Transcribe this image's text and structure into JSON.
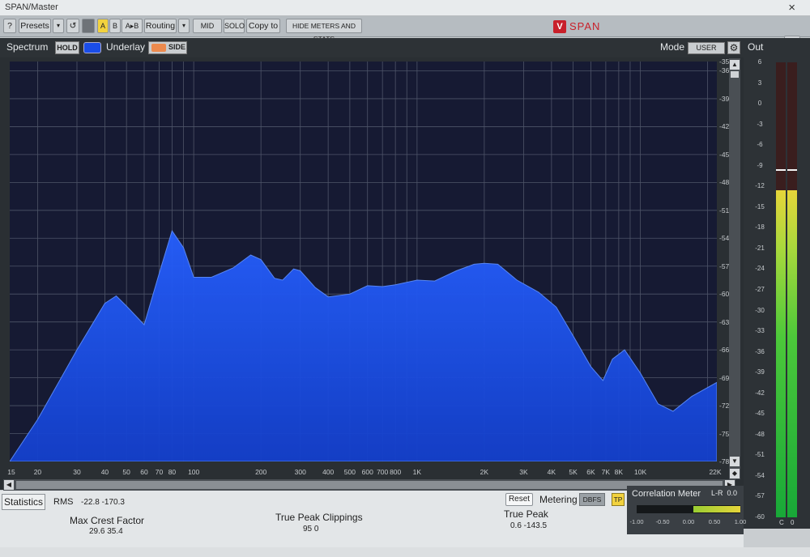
{
  "window": {
    "title": "SPAN/Master",
    "close": "×"
  },
  "toolbar": {
    "help": "?",
    "presets": "Presets",
    "dropdown": "▾",
    "undo": "↺",
    "a": "A",
    "b": "B",
    "ab": "A▸B",
    "routing": "Routing",
    "mid": "MID",
    "solo": "SOLO",
    "copy_to": "Copy to",
    "hide_meters": "HIDE METERS AND STATS",
    "brand": "SPAN",
    "logo": "V"
  },
  "spectrum": {
    "label": "Spectrum",
    "hold": "HOLD",
    "underlay": "Underlay",
    "side": "SIDE",
    "mode_label": "Mode",
    "mode_value": "USER",
    "gear": "⚙",
    "db_ticks": [
      "-35",
      "-36",
      "-39",
      "-42",
      "-45",
      "-48",
      "-51",
      "-54",
      "-57",
      "-60",
      "-63",
      "-66",
      "-69",
      "-72",
      "-75",
      "-78"
    ],
    "freq_ticks": [
      "15",
      "20",
      "30",
      "40",
      "50",
      "60",
      "70",
      "80",
      "100",
      "200",
      "300",
      "400",
      "500",
      "600",
      "700",
      "800",
      "1K",
      "2K",
      "3K",
      "4K",
      "5K",
      "6K",
      "7K",
      "8K",
      "10K",
      "22K"
    ],
    "colors": {
      "fill": "#1a4de8",
      "background": "#161a33",
      "grid": "#5a5f70"
    }
  },
  "output": {
    "label": "Out",
    "db_ticks": [
      "6",
      "3",
      "0",
      "-3",
      "-6",
      "-9",
      "-12",
      "-15",
      "-18",
      "-21",
      "-24",
      "-27",
      "-30",
      "-33",
      "-36",
      "-39",
      "-42",
      "-45",
      "-48",
      "-51",
      "-54",
      "-57",
      "-60"
    ],
    "left_level_db": -12.5,
    "right_level_db": -12.5,
    "peak_hold_db": -9.5,
    "channel_l": "C",
    "channel_r": "0"
  },
  "statistics": {
    "tab": "Statistics",
    "rms_label": "RMS",
    "rms_value": "-22.8  -170.3",
    "max_crest_label": "Max Crest Factor",
    "max_crest_values": "29.6   35.4",
    "tp_clip_label": "True Peak Clippings",
    "tp_clip_values": "95        0",
    "true_peak_label": "True Peak",
    "true_peak_values": "0.6    -143.5",
    "reset": "Reset",
    "metering_label": "Metering",
    "metering_value": "DBFS",
    "tp": "TP"
  },
  "correlation": {
    "title": "Correlation Meter",
    "lr": "L-R",
    "value": "0.0",
    "scale": [
      "-1.00",
      "-0.50",
      "0.00",
      "0.50",
      "1.00"
    ],
    "range": [
      0.1,
      1.0
    ]
  }
}
